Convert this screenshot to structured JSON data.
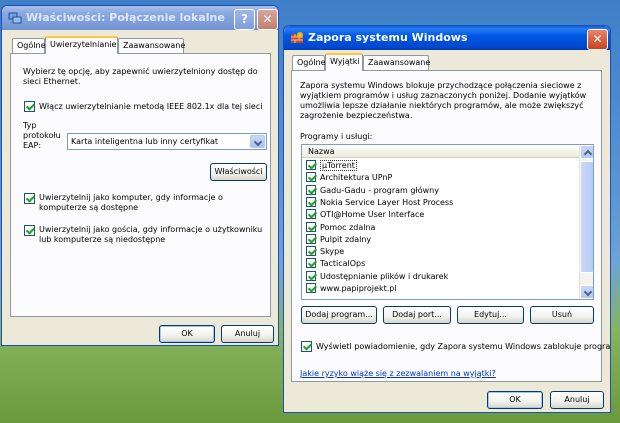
{
  "left_window": {
    "title": "Właściwości: Połączenie lokalne",
    "help_glyph": "?",
    "close_glyph": "✕",
    "tabs": [
      "Ogólne",
      "Uwierzytelnianie",
      "Zaawansowane"
    ],
    "selected_tab": "Uwierzytelnianie",
    "description": "Wybierz tę opcję, aby zapewnić uwierzytelniony dostęp do sieci Ethernet.",
    "enable_8021x": {
      "label": "Włącz uwierzytelnianie metodą IEEE 802.1x dla tej sieci",
      "checked": true
    },
    "eap_type_label": "Typ protokołu EAP:",
    "eap_type_value": "Karta inteligentna lub inny certyfikat",
    "properties_button": "Właściwości",
    "auth_as_computer": {
      "label": "Uwierzytelnij jako komputer, gdy informacje o komputerze są dostępne",
      "checked": true
    },
    "auth_as_guest": {
      "label": "Uwierzytelnij jako gościa, gdy informacje o użytkowniku lub komputerze są niedostępne",
      "checked": true
    },
    "ok_button": "OK",
    "cancel_button": "Anuluj"
  },
  "right_window": {
    "title": "Zapora systemu Windows",
    "close_glyph": "✕",
    "tabs": [
      "Ogólne",
      "Wyjątki",
      "Zaawansowane"
    ],
    "selected_tab": "Wyjątki",
    "description": "Zapora systemu Windows blokuje przychodzące połączenia sieciowe z wyjątkiem programów i usług zaznaczonych poniżej. Dodanie wyjątków umożliwia lepsze działanie niektórych programów, ale może zwiększyć zagrożenie bezpieczeństwa.",
    "programs_label": "Programy i usługi:",
    "column_header": "Nazwa",
    "programs": [
      {
        "name": "µTorrent",
        "checked": true,
        "selected": true
      },
      {
        "name": "Architektura UPnP",
        "checked": true
      },
      {
        "name": "Gadu-Gadu - program główny",
        "checked": true
      },
      {
        "name": "Nokia Service Layer Host Process",
        "checked": true
      },
      {
        "name": "OTI@Home User Interface",
        "checked": true
      },
      {
        "name": "Pomoc zdalna",
        "checked": true
      },
      {
        "name": "Pulpit zdalny",
        "checked": true
      },
      {
        "name": "Skype",
        "checked": true
      },
      {
        "name": "TacticalOps",
        "checked": true
      },
      {
        "name": "Udostępnianie plików i drukarek",
        "checked": true
      },
      {
        "name": "www.papiprojekt.pl",
        "checked": true
      }
    ],
    "add_program_button": "Dodaj program...",
    "add_port_button": "Dodaj port...",
    "edit_button": "Edytuj...",
    "delete_button": "Usuń",
    "notify_checkbox": {
      "label": "Wyświetl powiadomienie, gdy Zapora systemu Windows zablokuje program",
      "checked": true
    },
    "risk_link": "Jakie ryzyko wiąże się z zezwalaniem na wyjątki?",
    "ok_button": "OK",
    "cancel_button": "Anuluj"
  },
  "colors": {
    "dialog_bg": "#ece9d8",
    "titlebar_active": "#0058e6",
    "titlebar_inactive": "#8aa8e0",
    "close_button": "#c8431f",
    "link": "#0033cc",
    "checkmark": "#21a121"
  }
}
